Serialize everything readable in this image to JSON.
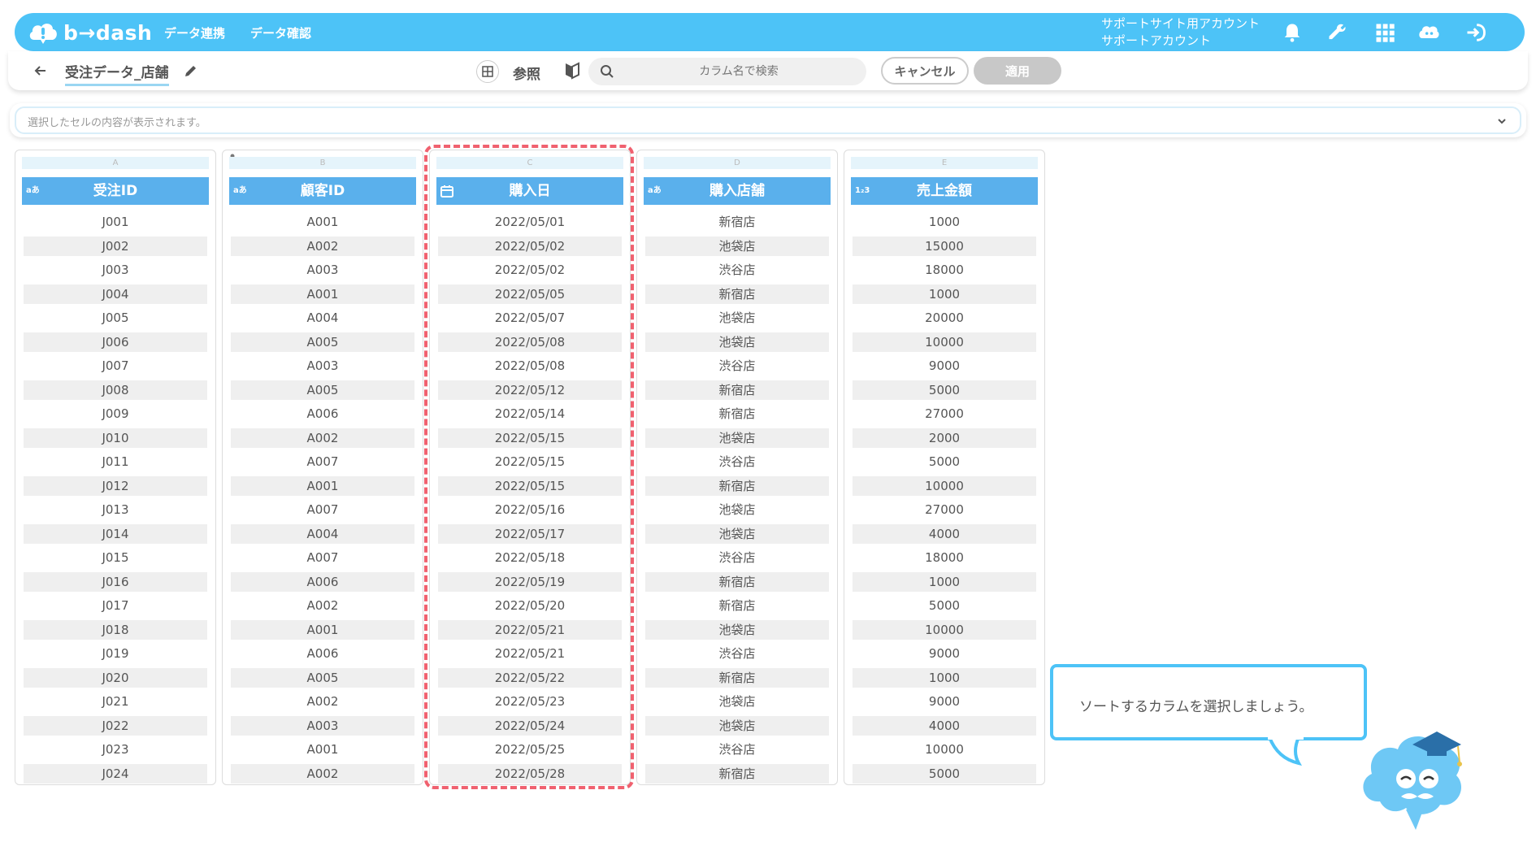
{
  "header": {
    "logo_text": "b→dash",
    "nav": [
      "データ連携",
      "データ確認"
    ],
    "account_line1": "サポートサイト用アカウント",
    "account_line2": "サポートアカウント",
    "icons": [
      "bell-icon",
      "wrench-icon",
      "apps-grid-icon",
      "chat-bot-icon",
      "logout-icon"
    ],
    "brand_color": "#4dc3f7"
  },
  "toolbar": {
    "table_name": "受注データ_店舗",
    "reference_label": "参照",
    "search_placeholder": "カラム名で検索",
    "cancel_label": "キャンセル",
    "apply_label": "適用"
  },
  "cellbar": {
    "placeholder": "選択したセルの内容が表示されます。"
  },
  "columns": [
    {
      "letter": "A",
      "type_icon": "aあ",
      "name": "受注ID",
      "values": [
        "J001",
        "J002",
        "J003",
        "J004",
        "J005",
        "J006",
        "J007",
        "J008",
        "J009",
        "J010",
        "J011",
        "J012",
        "J013",
        "J014",
        "J015",
        "J016",
        "J017",
        "J018",
        "J019",
        "J020",
        "J021",
        "J022",
        "J023",
        "J024"
      ]
    },
    {
      "letter": "B",
      "type_icon": "aあ",
      "name": "顧客ID",
      "values": [
        "A001",
        "A002",
        "A003",
        "A001",
        "A004",
        "A005",
        "A003",
        "A005",
        "A006",
        "A002",
        "A007",
        "A001",
        "A007",
        "A004",
        "A007",
        "A006",
        "A002",
        "A001",
        "A006",
        "A005",
        "A002",
        "A003",
        "A001",
        "A002"
      ]
    },
    {
      "letter": "C",
      "type_icon": "calendar-icon",
      "name": "購入日",
      "values": [
        "2022/05/01",
        "2022/05/02",
        "2022/05/02",
        "2022/05/05",
        "2022/05/07",
        "2022/05/08",
        "2022/05/08",
        "2022/05/12",
        "2022/05/14",
        "2022/05/15",
        "2022/05/15",
        "2022/05/15",
        "2022/05/16",
        "2022/05/17",
        "2022/05/18",
        "2022/05/19",
        "2022/05/20",
        "2022/05/21",
        "2022/05/21",
        "2022/05/22",
        "2022/05/23",
        "2022/05/24",
        "2022/05/25",
        "2022/05/28"
      ]
    },
    {
      "letter": "D",
      "type_icon": "aあ",
      "name": "購入店舗",
      "values": [
        "新宿店",
        "池袋店",
        "渋谷店",
        "新宿店",
        "池袋店",
        "池袋店",
        "渋谷店",
        "新宿店",
        "新宿店",
        "池袋店",
        "渋谷店",
        "新宿店",
        "池袋店",
        "池袋店",
        "渋谷店",
        "新宿店",
        "新宿店",
        "池袋店",
        "渋谷店",
        "新宿店",
        "池袋店",
        "池袋店",
        "渋谷店",
        "新宿店"
      ]
    },
    {
      "letter": "E",
      "type_icon": "1₂3",
      "name": "売上金額",
      "values": [
        "1000",
        "15000",
        "18000",
        "1000",
        "20000",
        "10000",
        "9000",
        "5000",
        "27000",
        "2000",
        "5000",
        "10000",
        "27000",
        "4000",
        "18000",
        "1000",
        "5000",
        "10000",
        "9000",
        "1000",
        "9000",
        "4000",
        "10000",
        "5000"
      ]
    }
  ],
  "tooltip": {
    "text": "ソートするカラムを選択しましょう。"
  }
}
